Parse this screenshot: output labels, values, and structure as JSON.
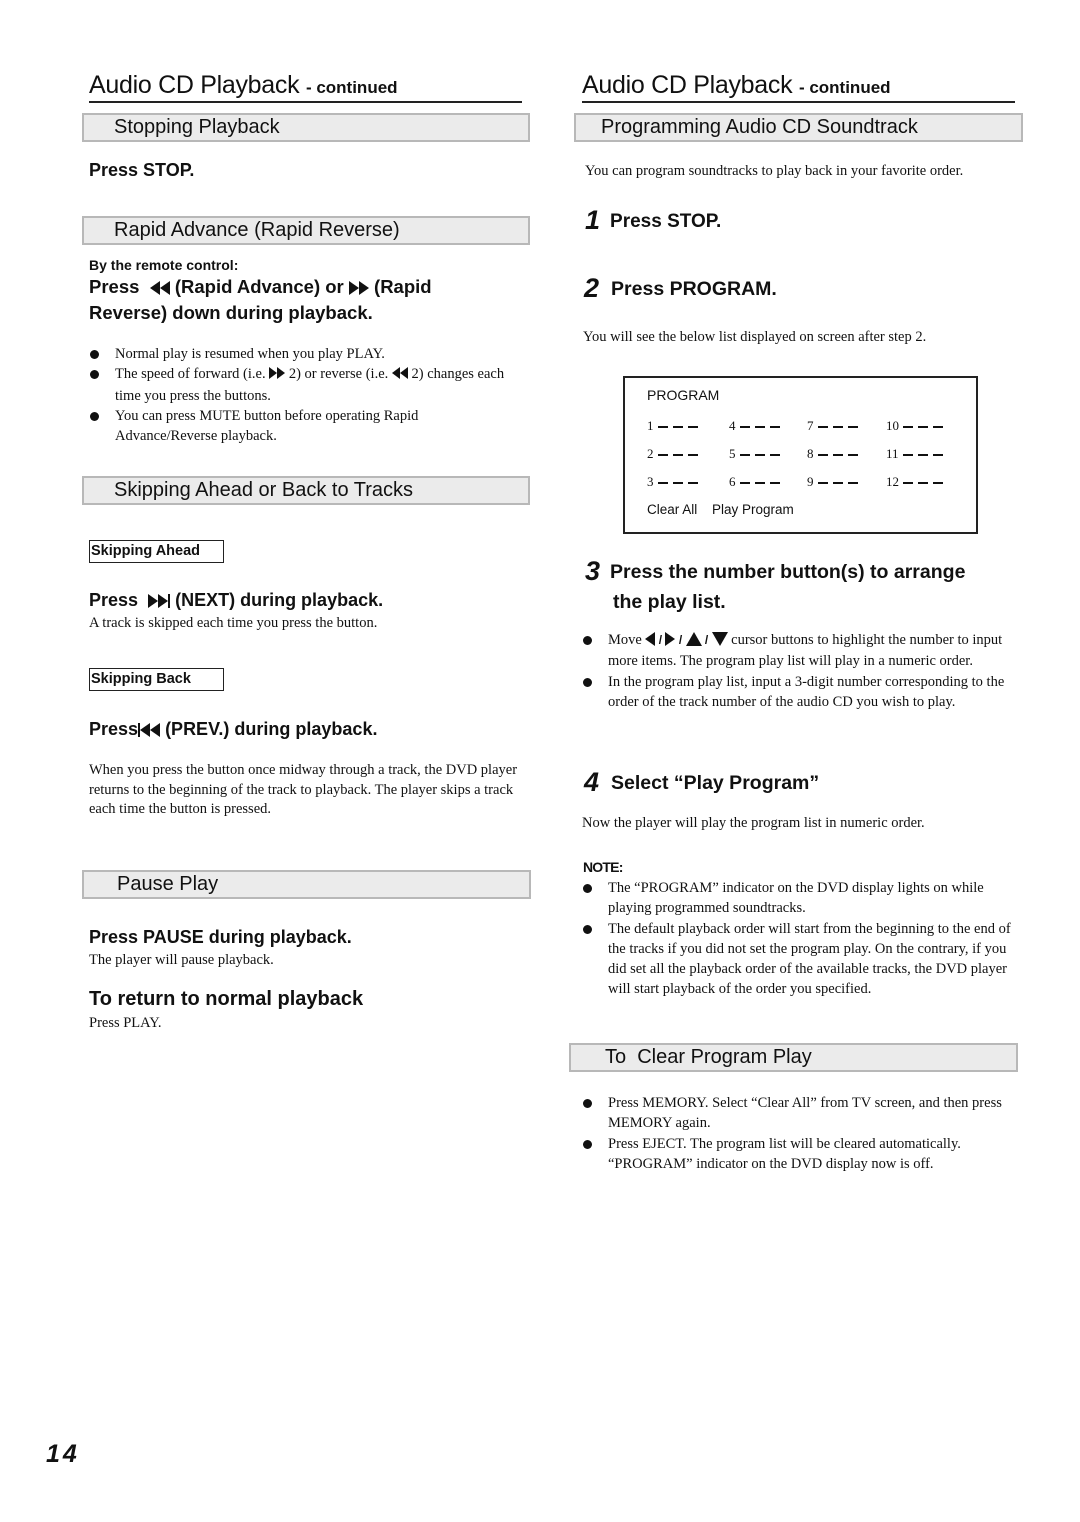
{
  "left": {
    "title": "Audio CD Playback",
    "title_suffix": "- continued",
    "stopping": {
      "heading": "Stopping Playback",
      "instruction": "Press STOP."
    },
    "rapid": {
      "heading": "Rapid Advance (Rapid Reverse)",
      "remote_label": "By the remote control:",
      "instr_press": "Press",
      "instr_part1": "(Rapid Advance) or",
      "instr_part2": "(Rapid",
      "instr_line2": "Reverse) down during playback.",
      "bullets": [
        {
          "text": "Normal play is resumed when you play PLAY."
        },
        {
          "pre": "The speed of forward (i.e.",
          "mid": "2) or reverse (i.e.",
          "post": "2) changes each time you press the buttons."
        },
        {
          "text": "You can press MUTE button before operating Rapid Advance/Reverse playback."
        }
      ],
      "icons": {
        "rewind": "fast-rewind-icon",
        "forward": "fast-forward-icon"
      }
    },
    "skipping": {
      "heading": "Skipping Ahead or Back to Tracks",
      "ahead_label": "Skipping Ahead",
      "ahead_press": "Press",
      "ahead_instruction": "(NEXT) during playback.",
      "ahead_note": "A track is skipped each time you press the button.",
      "back_label": "Skipping Back",
      "back_press": "Press",
      "back_instruction": "(PREV.) during playback.",
      "back_note": "When you press the button once midway through a track, the DVD player returns to the beginning of the track to playback. The player skips a track each time the button is pressed.",
      "icons": {
        "next": "skip-next-icon",
        "prev": "skip-previous-icon"
      }
    },
    "pause": {
      "heading": "Pause Play",
      "instruction": "Press PAUSE during playback.",
      "note": "The player will pause playback.",
      "return_heading": "To return to normal playback",
      "return_note": "Press PLAY."
    }
  },
  "right": {
    "title": "Audio CD Playback",
    "title_suffix": "- continued",
    "programming": {
      "heading": "Programming Audio CD Soundtrack",
      "intro": "You can program soundtracks to play back in your favorite order.",
      "steps": [
        {
          "num": "1",
          "text": "Press STOP."
        },
        {
          "num": "2",
          "text": "Press PROGRAM."
        },
        {
          "num": "3",
          "text_line1": "Press the number button(s) to arrange",
          "text_line2": "the play list."
        },
        {
          "num": "4",
          "text": "Select “Play Program”"
        }
      ],
      "step2_note": "You will see the below list displayed on screen after step 2.",
      "program_screen": {
        "title": "PROGRAM",
        "slots": [
          "1",
          "2",
          "3",
          "4",
          "5",
          "6",
          "7",
          "8",
          "9",
          "10",
          "11",
          "12"
        ],
        "options": [
          "Clear All",
          "Play Program"
        ]
      },
      "step3_bullets": {
        "move_pre": "Move",
        "move_post": "cursor buttons to highlight  the number to input more items. The program play list will play in a numeric order.",
        "second": "In the program play list, input a 3-digit number corresponding to the order of the track number of the audio CD you wish to play.",
        "icons": [
          "cursor-left-icon",
          "cursor-right-icon",
          "cursor-up-icon",
          "cursor-down-icon"
        ]
      },
      "step4_note": "Now the player will play the program list in numeric order.",
      "note_label": "NOTE:",
      "notes": [
        "The “PROGRAM” indicator on the DVD display lights on while playing programmed soundtracks.",
        "The default playback order will start from the beginning to the end of the tracks if you did not set the program play. On the contrary, if you did set all the playback order of the available tracks, the DVD player will start playback of the order you specified."
      ]
    },
    "clear": {
      "heading": "To  Clear Program Play",
      "bullets": [
        "Press MEMORY. Select “Clear All” from TV screen, and then press MEMORY again.",
        "Press EJECT. The program list will be cleared automatically. “PROGRAM” indicator on the DVD display now is off."
      ]
    }
  },
  "page_number": "14"
}
